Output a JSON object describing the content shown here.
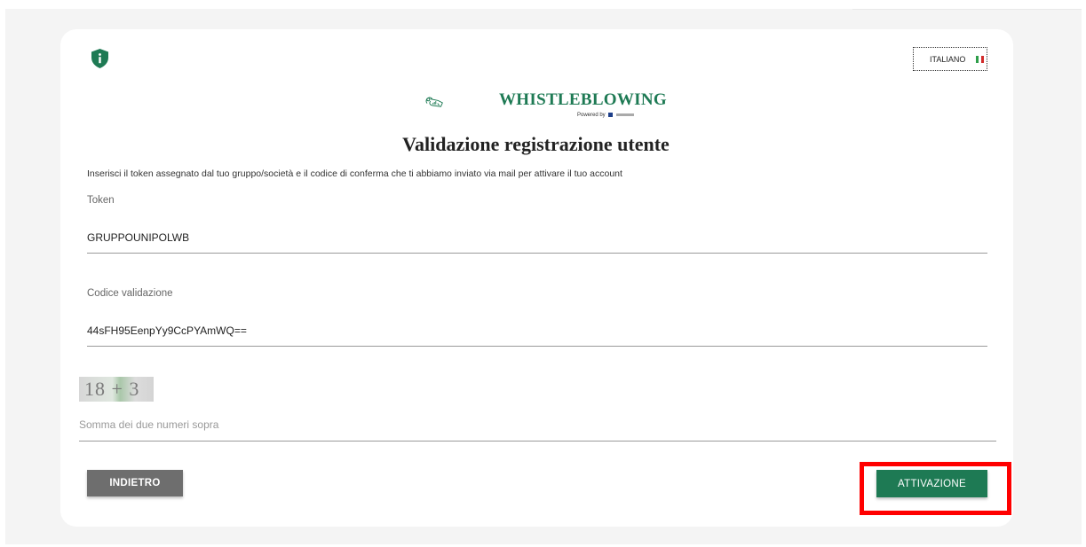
{
  "header": {
    "language_label": "ITALIANO",
    "flag_colors": [
      "#2e9e4a",
      "#ffffff",
      "#d22b2b"
    ],
    "shield_icon": "shield-info-icon",
    "accent_color": "#1e7a54"
  },
  "logo": {
    "title": "WHISTLEBLOWING",
    "powered_by": "Powered by"
  },
  "page": {
    "title": "Validazione registrazione utente",
    "instructions": "Inserisci il token assegnato dal tuo gruppo/società e il codice di conferma che ti abbiamo inviato via mail per attivare il tuo account"
  },
  "form": {
    "token_label": "Token",
    "token_value": "GRUPPOUNIPOLWB",
    "code_label": "Codice validazione",
    "code_value": "44sFH95EenpYy9CcPYAmWQ==",
    "captcha_text": "18 + 3",
    "captcha_placeholder": "Somma dei due numeri sopra"
  },
  "actions": {
    "back_label": "INDIETRO",
    "activate_label": "ATTIVAZIONE",
    "highlight_color": "#ff0000"
  }
}
